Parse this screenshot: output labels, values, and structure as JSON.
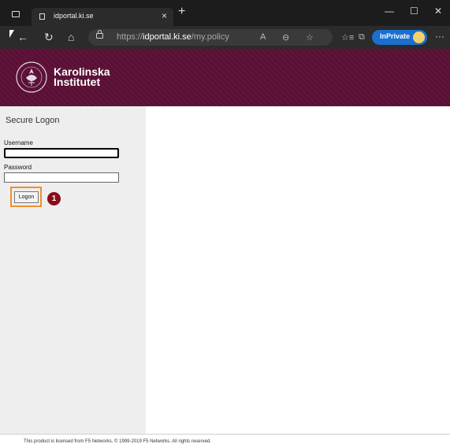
{
  "browser": {
    "tab_title": "idportal.ki.se",
    "tab_close": "×",
    "new_tab": "+",
    "url_scheme": "https://",
    "url_host": "idportal.ki.se",
    "url_path": "/my.policy",
    "inprivate_label": "InPrivate",
    "more_label": "···",
    "window_controls": {
      "minimize": "—",
      "maximize": "☐",
      "close": "✕"
    },
    "nav": {
      "back": "←",
      "refresh": "↻",
      "home": "⌂"
    },
    "url_actions": {
      "read_aloud": "A",
      "zoom": "⊖",
      "favorite": "☆",
      "favorites_bar": "☆≡",
      "collections": "⧉"
    }
  },
  "banner": {
    "logo_line1": "Karolinska",
    "logo_line2": "Institutet",
    "accent": "#5a0f34"
  },
  "form": {
    "title": "Secure Logon",
    "username_label": "Username",
    "username_value": "",
    "password_label": "Password",
    "password_value": "",
    "logon_label": "Logon"
  },
  "annotation": {
    "step": "1",
    "highlight_color": "#f0902a",
    "badge_color": "#8a0c1a"
  },
  "footer": {
    "text": "This product is licensed from F5 Networks. © 1999-2019 F5 Networks. All rights reserved."
  }
}
